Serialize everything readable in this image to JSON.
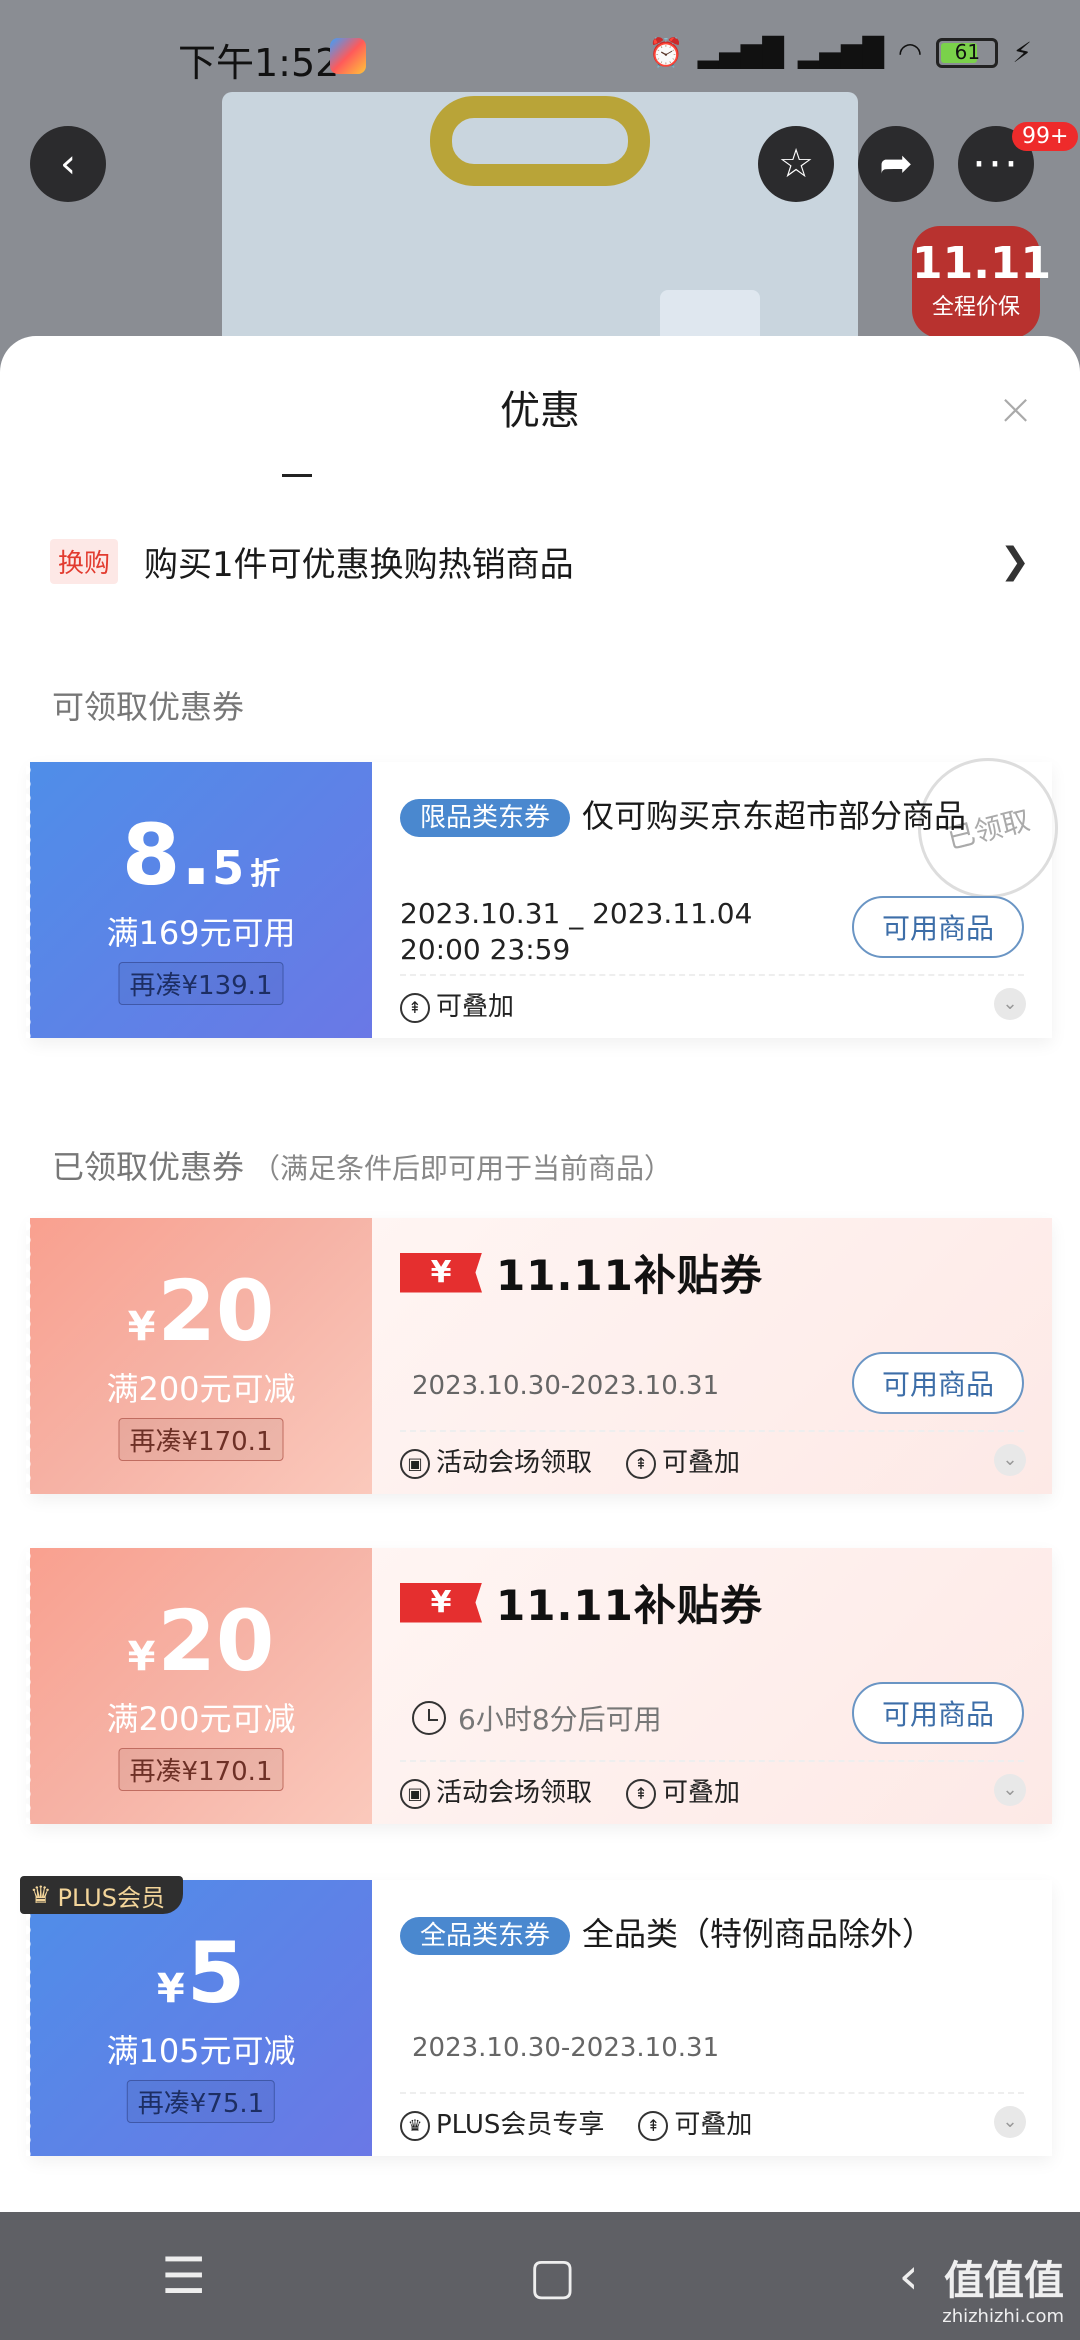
{
  "status_bar": {
    "time": "下午1:52",
    "battery": "61"
  },
  "product_badge": {
    "big": "11.11",
    "small": "全程价保"
  },
  "top_bar": {
    "more_badge": "99+"
  },
  "sheet": {
    "title": "优惠",
    "close": "×",
    "swap": {
      "tag": "换购",
      "text": "购买1件可优惠换购热销商品",
      "arrow": "❯"
    }
  },
  "sections": {
    "claimable_title": "可领取优惠券",
    "claimed_title": "已领取优惠券",
    "claimed_sub": "（满足条件后即可用于当前商品）"
  },
  "coupons": [
    {
      "amount_big": "8.",
      "amount_mid": "5",
      "amount_unit": "折",
      "condition": "满169元可用",
      "gap": "再凑¥139.1",
      "tag": "限品类东券",
      "title": "仅可购买京东超市部分商品",
      "date_line1": "2023.10.31 _ 2023.11.04",
      "date_line2": "20:00 23:59",
      "button": "可用商品",
      "stackable": "可叠加",
      "stamp": "已领取"
    },
    {
      "yen": "¥",
      "amount_big": "20",
      "condition": "满200元可减",
      "gap": "再凑¥170.1",
      "brand_yen": "¥",
      "brand_text": "11.11补贴券",
      "dates": "2023.10.30-2023.10.31",
      "button": "可用商品",
      "source": "活动会场领取",
      "stackable": "可叠加"
    },
    {
      "yen": "¥",
      "amount_big": "20",
      "condition": "满200元可减",
      "gap": "再凑¥170.1",
      "brand_yen": "¥",
      "brand_text": "11.11补贴券",
      "wait": "6小时8分后可用",
      "button": "可用商品",
      "source": "活动会场领取",
      "stackable": "可叠加"
    },
    {
      "ribbon": "PLUS会员",
      "yen": "¥",
      "amount_big": "5",
      "condition": "满105元可减",
      "gap": "再凑¥75.1",
      "tag": "全品类东券",
      "title": "全品类（特例商品除外）",
      "dates": "2023.10.30-2023.10.31",
      "source": "PLUS会员专享",
      "stackable": "可叠加"
    }
  ],
  "navbar": {
    "menu": "☰",
    "home": "▢",
    "back": "‹"
  },
  "watermark": {
    "text": "值值值",
    "url": "zhizhizhi.com"
  },
  "colors": {
    "accent_red": "#e23b2f",
    "coupon_blue": "#4f8ee8",
    "coupon_pink": "#f9a08f",
    "button_blue": "#3d6ea8"
  }
}
